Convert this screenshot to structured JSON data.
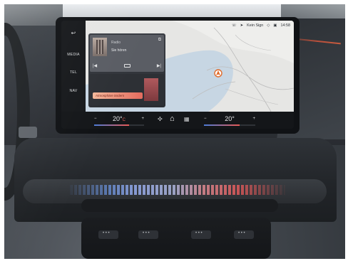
{
  "screen": {
    "sidebar": {
      "back_icon": "back-arrow-icon",
      "items": [
        {
          "label": "MEDIA"
        },
        {
          "label": "TEL"
        },
        {
          "label": "NAV"
        }
      ]
    },
    "status_bar": {
      "left_icons": [
        "phone-icon",
        "location-arrow-icon"
      ],
      "signal_text": "Kein Sign",
      "mid_icons": [
        "wifi-icon",
        "cast-icon"
      ],
      "time": "14:58"
    },
    "media_widget": {
      "source": "Radio",
      "subtitle": "Sie hören",
      "controls": [
        "skip-back-icon",
        "mode-icon",
        "skip-forward-icon"
      ]
    },
    "ambient_widget": {
      "button_label": "Atmosphäre ändern"
    },
    "climate": {
      "left": {
        "minus": "−",
        "temperature": "20°",
        "plus": "+",
        "unit_label": "C"
      },
      "right": {
        "minus": "−",
        "temperature": "20°",
        "plus": "+"
      },
      "fan_icon": "fan-icon",
      "home_icon": "home-icon",
      "apps_icon": "grid-icon"
    },
    "map": {
      "accent": "#e06b2b"
    }
  }
}
